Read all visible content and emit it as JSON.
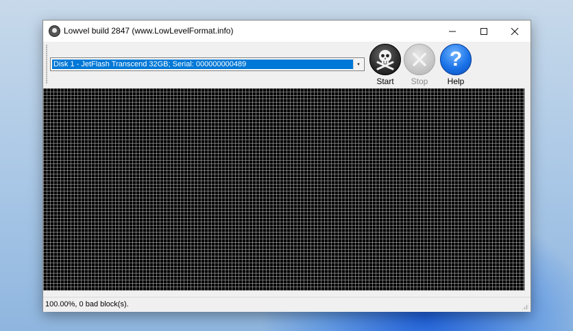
{
  "window": {
    "title": "Lowvel build 2847 (www.LowLevelFormat.info)",
    "app_icon": "app-icon",
    "caption_icons": {
      "minimize": "—",
      "maximize": "☐",
      "close": "✕"
    }
  },
  "toolbar": {
    "drive_select": {
      "value": "Disk 1 - JetFlash Transcend 32GB; Serial: 000000000489",
      "arrow": "▾"
    },
    "start": {
      "label": "Start",
      "icon": "skull-crossbones-icon"
    },
    "stop": {
      "label": "Stop",
      "icon": "stop-x-icon",
      "enabled": false
    },
    "help": {
      "label": "Help",
      "icon": "question-mark-icon",
      "glyph": "?"
    }
  },
  "sector_map": {
    "state": "all blocks processed"
  },
  "status": {
    "text": "100.00%, 0 bad block(s)."
  },
  "colors": {
    "selection": "#0078d7",
    "map_background": "#000000",
    "help_button": "#1a73e8"
  }
}
